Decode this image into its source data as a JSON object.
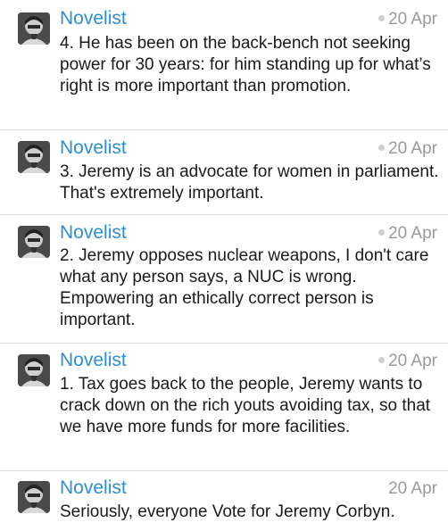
{
  "tweets": [
    {
      "author": "Novelist",
      "time": "20 Apr",
      "has_dot": true,
      "text": "4. He has been on the back-bench not seeking power for 30 years: for him standing up for what’s right is more important than promotion."
    },
    {
      "author": "Novelist",
      "time": "20 Apr",
      "has_dot": true,
      "text": "3. Jeremy is an advocate for women in parliament. That's extremely important."
    },
    {
      "author": "Novelist",
      "time": "20 Apr",
      "has_dot": true,
      "text": "2. Jeremy opposes nuclear weapons, I don't care what any person says, a NUC is wrong. Empowering an ethically correct person is important."
    },
    {
      "author": "Novelist",
      "time": "20 Apr",
      "has_dot": true,
      "text": "1. Tax goes back to the people, Jeremy wants to crack down on the rich youts avoiding tax, so that we have more funds for more facilities."
    },
    {
      "author": "Novelist",
      "time": "20 Apr",
      "has_dot": false,
      "text": "Seriously, everyone Vote for Jeremy Corbyn."
    }
  ]
}
